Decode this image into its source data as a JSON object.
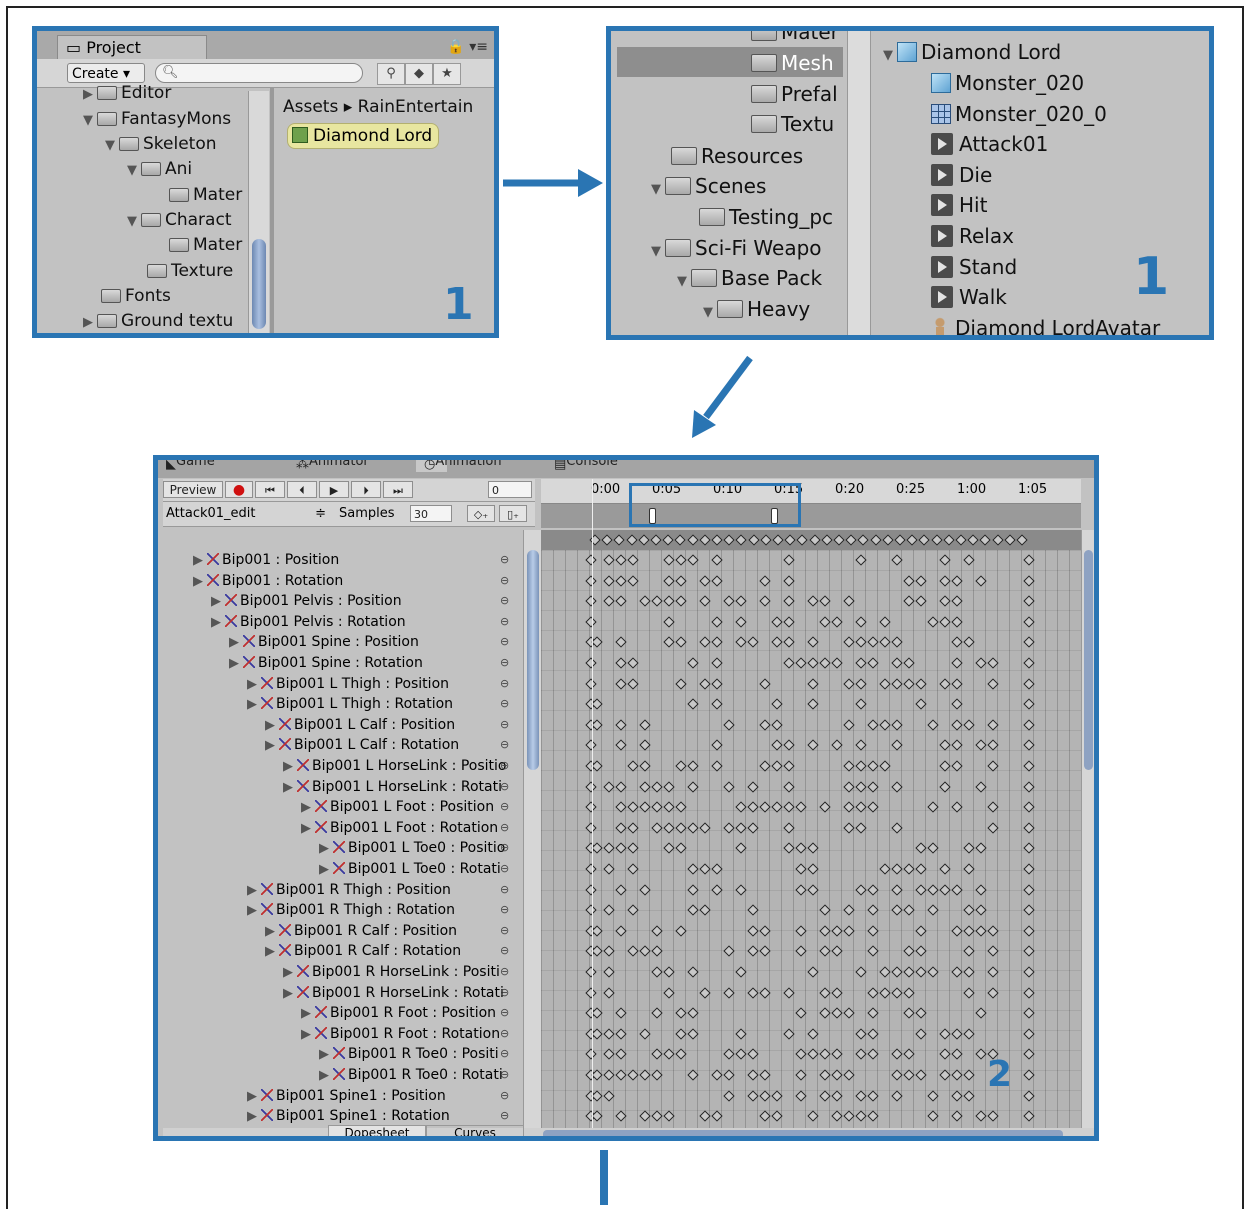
{
  "panel1": {
    "tab": "Project",
    "create": "Create",
    "search_placeholder": "",
    "tree": [
      "Editor",
      "FantasyMons",
      "Skeleton",
      "Ani",
      "Mater",
      "Charact",
      "Mater",
      "Texture",
      "Fonts",
      "Ground textu"
    ],
    "breadcrumb": "Assets ▸ RainEntertain",
    "asset": "Diamond Lord",
    "number": "1"
  },
  "panel2": {
    "left_tree": [
      "Mater",
      "Mesh",
      "Prefal",
      "Textu",
      "Resources",
      "Scenes",
      "Testing_pc",
      "Sci-Fi Weapo",
      "Base Pack",
      "Heavy"
    ],
    "right_tree": [
      "Diamond Lord",
      "Monster_020",
      "Monster_020_0",
      "Attack01",
      "Die",
      "Hit",
      "Relax",
      "Stand",
      "Walk",
      "Diamond LordAvatar"
    ],
    "number": "1"
  },
  "panel3": {
    "tabs": [
      "Game",
      "Animator",
      "Animation",
      "Console"
    ],
    "preview": "Preview",
    "frame": "0",
    "clip": "Attack01_edit",
    "samples_label": "Samples",
    "samples": "30",
    "ticks": [
      "0:00",
      "0:05",
      "0:10",
      "0:15",
      "0:20",
      "0:25",
      "1:00",
      "1:05"
    ],
    "properties": [
      "Bip001 : Position",
      "Bip001 : Rotation",
      "Bip001 Pelvis : Position",
      "Bip001 Pelvis : Rotation",
      "Bip001 Spine : Position",
      "Bip001 Spine : Rotation",
      "Bip001 L Thigh : Position",
      "Bip001 L Thigh : Rotation",
      "Bip001 L Calf : Position",
      "Bip001 L Calf : Rotation",
      "Bip001 L HorseLink : Positio",
      "Bip001 L HorseLink : Rotati",
      "Bip001 L Foot : Position",
      "Bip001 L Foot : Rotation",
      "Bip001 L Toe0 : Positio",
      "Bip001 L Toe0 : Rotati",
      "Bip001 R Thigh : Position",
      "Bip001 R Thigh : Rotation",
      "Bip001 R Calf : Position",
      "Bip001 R Calf : Rotation",
      "Bip001 R HorseLink : Positi",
      "Bip001 R HorseLink : Rotati",
      "Bip001 R Foot : Position",
      "Bip001 R Foot : Rotation",
      "Bip001 R Toe0 : Positi",
      "Bip001 R Toe0 : Rotati",
      "Bip001 Spine1 : Position",
      "Bip001 Spine1 : Rotation"
    ],
    "dopesheet": "Dopesheet",
    "curves": "Curves",
    "number": "2"
  }
}
